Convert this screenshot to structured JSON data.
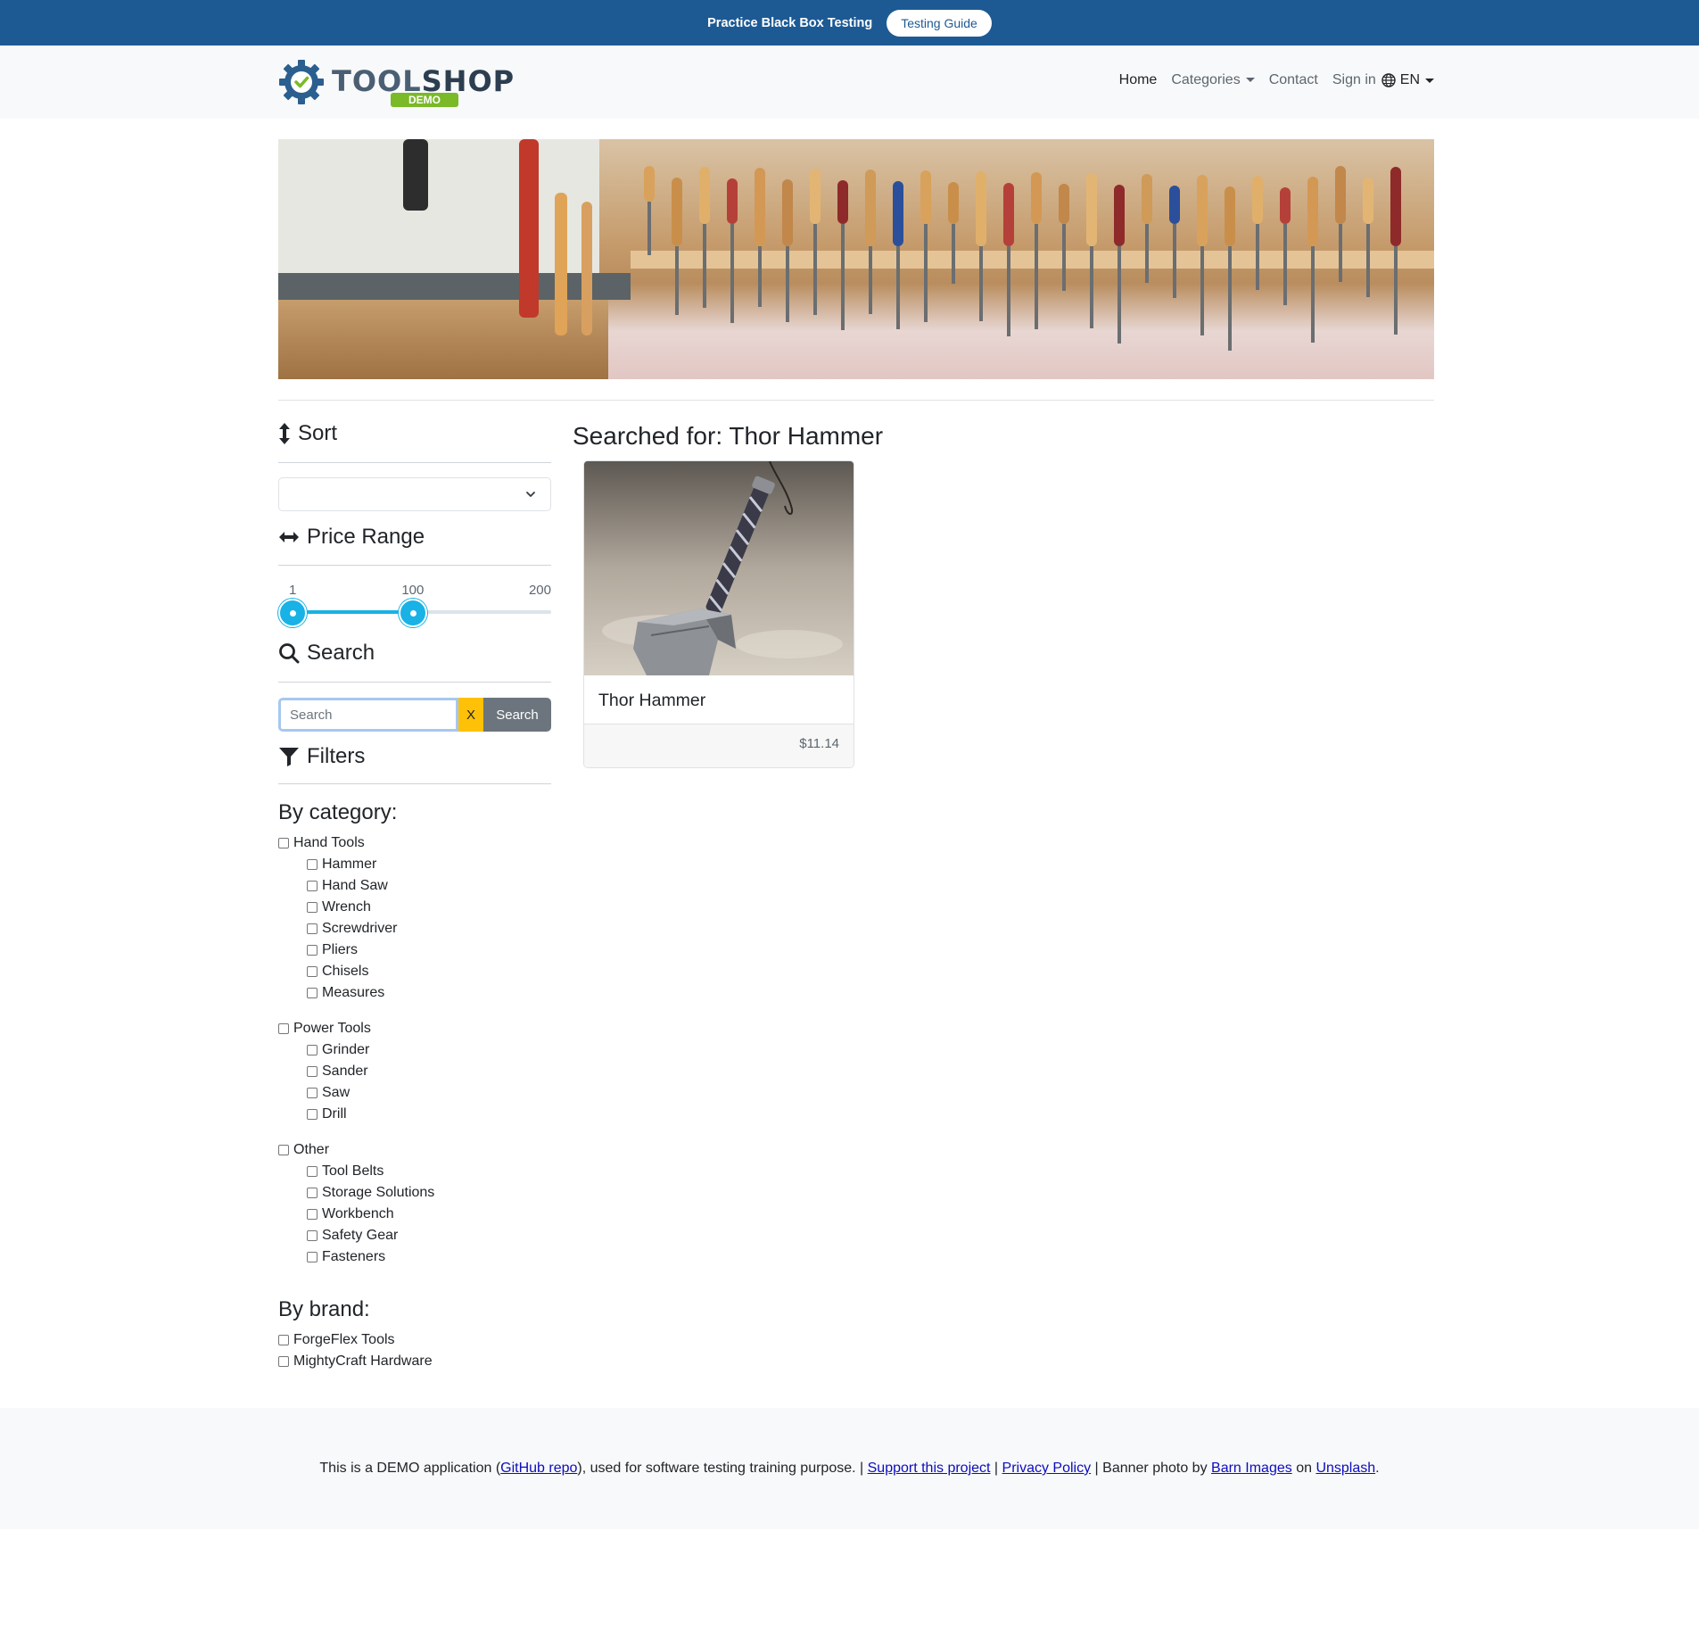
{
  "topbar": {
    "text": "Practice Black Box Testing",
    "button_label": "Testing Guide"
  },
  "navbar": {
    "logo_word_a": "TOOL",
    "logo_word_b": "SHOP",
    "logo_badge": "DEMO",
    "links": {
      "home": "Home",
      "categories": "Categories",
      "contact": "Contact",
      "sign_in": "Sign in",
      "language": "EN"
    }
  },
  "sidebar": {
    "sort": {
      "heading": "Sort",
      "selected": ""
    },
    "price_range": {
      "heading": "Price Range",
      "min_label": "1",
      "value_label": "100",
      "max_label": "200",
      "min": 1,
      "max": 200,
      "low": 1,
      "high": 100
    },
    "search": {
      "heading": "Search",
      "placeholder": "Search",
      "clear_label": "X",
      "button_label": "Search"
    },
    "filters": {
      "heading": "Filters",
      "by_category": "By category:",
      "categories": [
        {
          "label": "Hand Tools",
          "children": [
            "Hammer",
            "Hand Saw",
            "Wrench",
            "Screwdriver",
            "Pliers",
            "Chisels",
            "Measures"
          ]
        },
        {
          "label": "Power Tools",
          "children": [
            "Grinder",
            "Sander",
            "Saw",
            "Drill"
          ]
        },
        {
          "label": "Other",
          "children": [
            "Tool Belts",
            "Storage Solutions",
            "Workbench",
            "Safety Gear",
            "Fasteners"
          ]
        }
      ],
      "by_brand": "By brand:",
      "brands": [
        "ForgeFlex Tools",
        "MightyCraft Hardware"
      ]
    }
  },
  "results": {
    "heading": "Searched for: Thor Hammer",
    "products": [
      {
        "name": "Thor Hammer",
        "price": "$11.14"
      }
    ]
  },
  "footer": {
    "text_1": "This is a DEMO application (",
    "link_github": "GitHub repo",
    "text_2": "), used for software testing training purpose. | ",
    "link_support": "Support this project",
    "text_3": " | ",
    "link_privacy": "Privacy Policy",
    "text_4": " | Banner photo by ",
    "link_barn": "Barn Images",
    "text_5": " on ",
    "link_unsplash": "Unsplash",
    "text_6": "."
  }
}
